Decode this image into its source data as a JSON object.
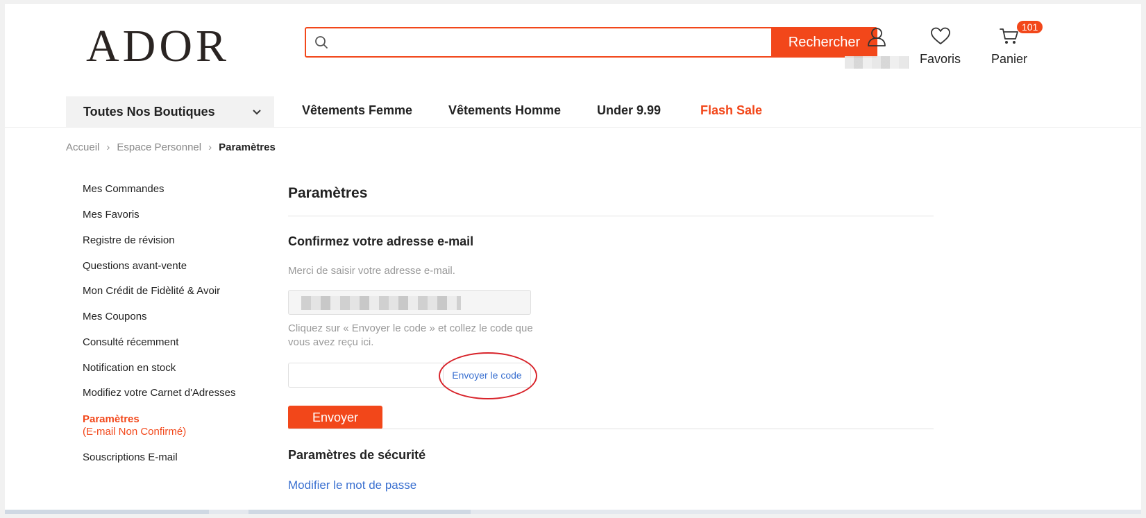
{
  "header": {
    "logo": "ADOR",
    "search_placeholder": "",
    "search_button": "Rechercher",
    "account_label": "",
    "favorites_label": "Favoris",
    "cart_label": "Panier",
    "cart_count": "101"
  },
  "nav": {
    "all_shops": "Toutes Nos Boutiques",
    "links": [
      "Vêtements Femme",
      "Vêtements Homme",
      "Under 9.99",
      "Flash Sale"
    ]
  },
  "breadcrumb": [
    "Accueil",
    "Espace Personnel",
    "Paramètres"
  ],
  "sidebar": {
    "items": [
      "Mes Commandes",
      "Mes Favoris",
      "Registre de révision",
      "Questions avant-vente",
      "Mon Crédit de Fidèlité & Avoir",
      "Mes Coupons",
      "Consulté récemment",
      "Notification en stock",
      "Modifiez votre Carnet d'Adresses",
      "Paramètres",
      "Souscriptions E-mail"
    ],
    "active_sub": "(E-mail Non Confirmé)"
  },
  "main": {
    "title": "Paramètres",
    "confirm_heading": "Confirmez votre adresse e-mail",
    "email_hint": "Merci de saisir votre adresse e-mail.",
    "code_hint": "Cliquez sur « Envoyer le code » et collez le code que vous avez reçu ici.",
    "send_code_label": "Envoyer le code",
    "submit_label": "Envoyer",
    "security_heading": "Paramètres de sécurité",
    "change_password_link": "Modifier le mot de passe"
  },
  "colors": {
    "accent": "#f2471a",
    "link": "#3a70d0",
    "annotation": "#d8232a"
  }
}
